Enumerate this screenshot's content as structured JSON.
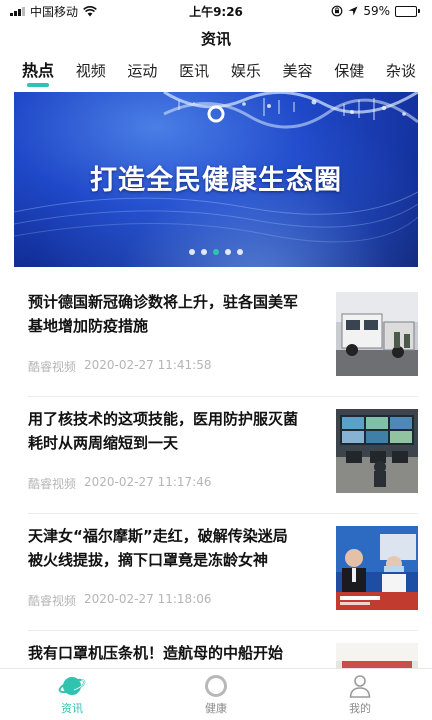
{
  "status_bar": {
    "carrier": "中国移动",
    "time": "上午9:26",
    "battery": "59%",
    "battery_level": 0.59
  },
  "app_title": "资讯",
  "tabs": [
    {
      "label": "热点",
      "active": true
    },
    {
      "label": "视频",
      "active": false
    },
    {
      "label": "运动",
      "active": false
    },
    {
      "label": "医讯",
      "active": false
    },
    {
      "label": "娱乐",
      "active": false
    },
    {
      "label": "美容",
      "active": false
    },
    {
      "label": "保健",
      "active": false
    },
    {
      "label": "杂谈",
      "active": false
    }
  ],
  "banner": {
    "headline": "打造全民健康生态圈",
    "slide_count": 5,
    "active_slide": 3
  },
  "news": [
    {
      "title": "预计德国新冠确诊数将上升，驻各国美军基地增加防疫措施",
      "source": "酷睿视频",
      "time": "2020-02-27 11:41:58",
      "thumb": "military-vehicle-photo"
    },
    {
      "title": "用了核技术的这项技能，医用防护服灭菌耗时从两周缩短到一天",
      "source": "酷睿视频",
      "time": "2020-02-27 11:17:46",
      "thumb": "control-room-photo"
    },
    {
      "title": "天津女“福尔摩斯”走红，破解传染迷局被火线提拔，摘下口罩竟是冻龄女神",
      "source": "酷睿视频",
      "time": "2020-02-27 11:18:06",
      "thumb": "news-broadcast-photo"
    },
    {
      "title": "我有口罩机压条机！造航母的中船开始",
      "source": "",
      "time": "",
      "thumb": "factory-photo"
    }
  ],
  "bottom_nav": [
    {
      "label": "资讯",
      "icon": "planet-icon",
      "active": true
    },
    {
      "label": "健康",
      "icon": "ring-icon",
      "active": false
    },
    {
      "label": "我的",
      "icon": "user-icon",
      "active": false
    }
  ],
  "colors": {
    "accent": "#2fc3b0",
    "banner_blue": "#1f48c8",
    "meta_gray": "#b5b5b5"
  }
}
